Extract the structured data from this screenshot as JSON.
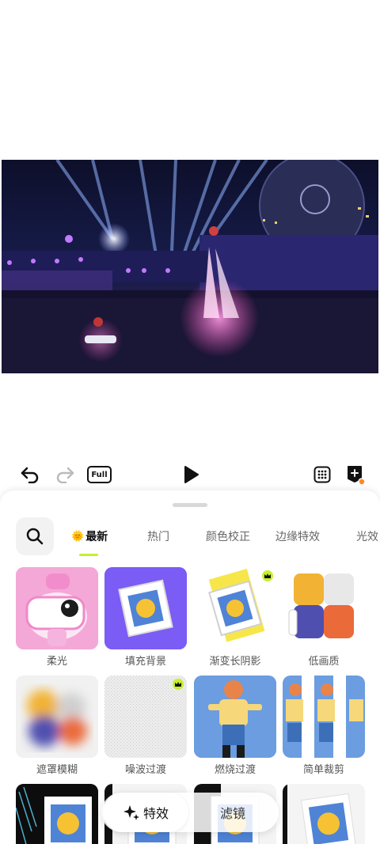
{
  "toolbar": {
    "undo_icon": "undo-icon",
    "redo_icon": "redo-icon",
    "full_label": "Full",
    "play_icon": "play-icon",
    "grid_icon": "grid-icon",
    "add_keyframe_icon": "add-keyframe-icon"
  },
  "tabs": [
    {
      "label": "最新",
      "active": true
    },
    {
      "label": "热门",
      "active": false
    },
    {
      "label": "颜色校正",
      "active": false
    },
    {
      "label": "边缘特效",
      "active": false
    },
    {
      "label": "光效",
      "active": false
    }
  ],
  "effects": [
    {
      "label": "柔光",
      "premium": false
    },
    {
      "label": "填充背景",
      "premium": false
    },
    {
      "label": "渐变长阴影",
      "premium": true
    },
    {
      "label": "低画质",
      "premium": false
    },
    {
      "label": "遮罩模糊",
      "premium": false
    },
    {
      "label": "噪波过渡",
      "premium": true
    },
    {
      "label": "燃烧过渡",
      "premium": false
    },
    {
      "label": "简单裁剪",
      "premium": false
    }
  ],
  "bottom_switch": {
    "effects_label": "特效",
    "filters_label": "滤镜"
  },
  "colors": {
    "accent": "#c6ef2d",
    "purple": "#7b5cf5"
  }
}
